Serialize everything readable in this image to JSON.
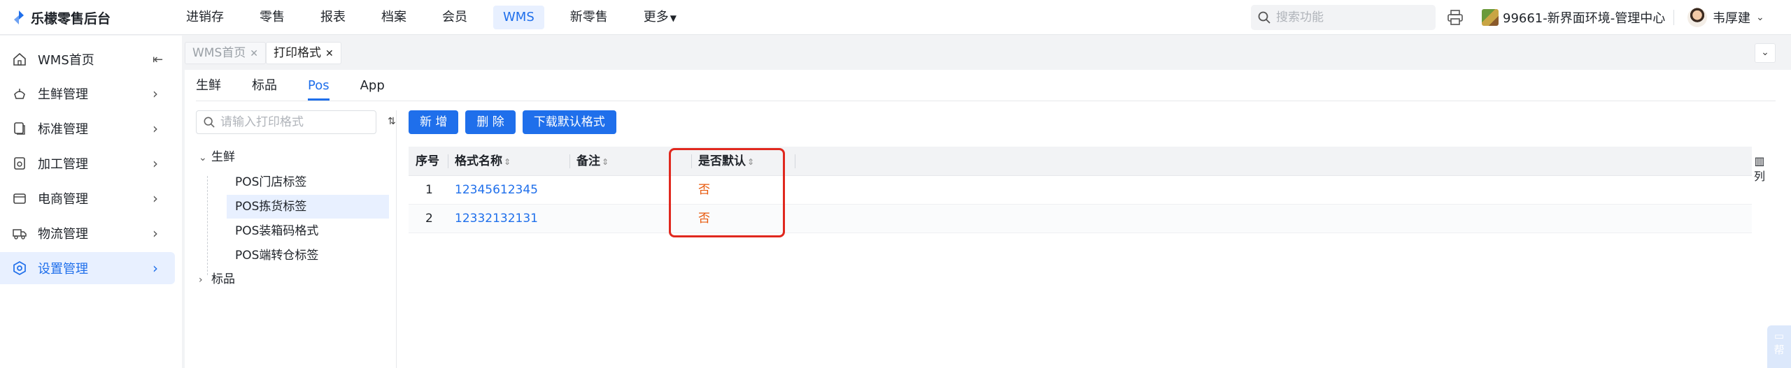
{
  "app": {
    "title": "乐檬零售后台"
  },
  "topnav": {
    "items": [
      "进销存",
      "零售",
      "报表",
      "档案",
      "会员",
      "WMS",
      "新零售",
      "更多"
    ],
    "active": "WMS"
  },
  "search": {
    "placeholder": "搜索功能"
  },
  "store": {
    "name": "99661-新界面环境-管理中心"
  },
  "user": {
    "name": "韦厚建"
  },
  "sidebar": {
    "items": [
      {
        "label": "WMS首页",
        "icon": "home-icon"
      },
      {
        "label": "生鲜管理",
        "icon": "fresh-icon"
      },
      {
        "label": "标准管理",
        "icon": "standard-icon"
      },
      {
        "label": "加工管理",
        "icon": "process-icon"
      },
      {
        "label": "电商管理",
        "icon": "ecommerce-icon"
      },
      {
        "label": "物流管理",
        "icon": "truck-icon"
      },
      {
        "label": "设置管理",
        "icon": "settings-icon"
      }
    ],
    "active": "设置管理"
  },
  "page_tabs": [
    {
      "label": "WMS首页",
      "active": false
    },
    {
      "label": "打印格式",
      "active": true
    }
  ],
  "sub_tabs": {
    "items": [
      "生鲜",
      "标品",
      "Pos",
      "App"
    ],
    "active": "Pos"
  },
  "tree": {
    "search_placeholder": "请输入打印格式",
    "nodes": [
      {
        "label": "生鲜",
        "expanded": true
      },
      {
        "label": "标品",
        "expanded": false
      }
    ],
    "leaves": [
      "POS门店标签",
      "POS拣货标签",
      "POS装箱码格式",
      "POS端转仓标签"
    ],
    "selected": "POS拣货标签"
  },
  "toolbar": {
    "add": "新 增",
    "delete": "删 除",
    "download": "下载默认格式"
  },
  "table": {
    "headers": [
      "序号",
      "格式名称",
      "备注",
      "是否默认"
    ],
    "rows": [
      {
        "index": "1",
        "name": "12345612345",
        "remark": "",
        "default": "否"
      },
      {
        "index": "2",
        "name": "12332132131",
        "remark": "",
        "default": "否"
      }
    ]
  },
  "column_setting": {
    "label": "列"
  },
  "help": {
    "label": "帮"
  },
  "colors": {
    "accent": "#1f6feb",
    "danger_box": "#e0281e",
    "no_text": "#e8590c"
  }
}
